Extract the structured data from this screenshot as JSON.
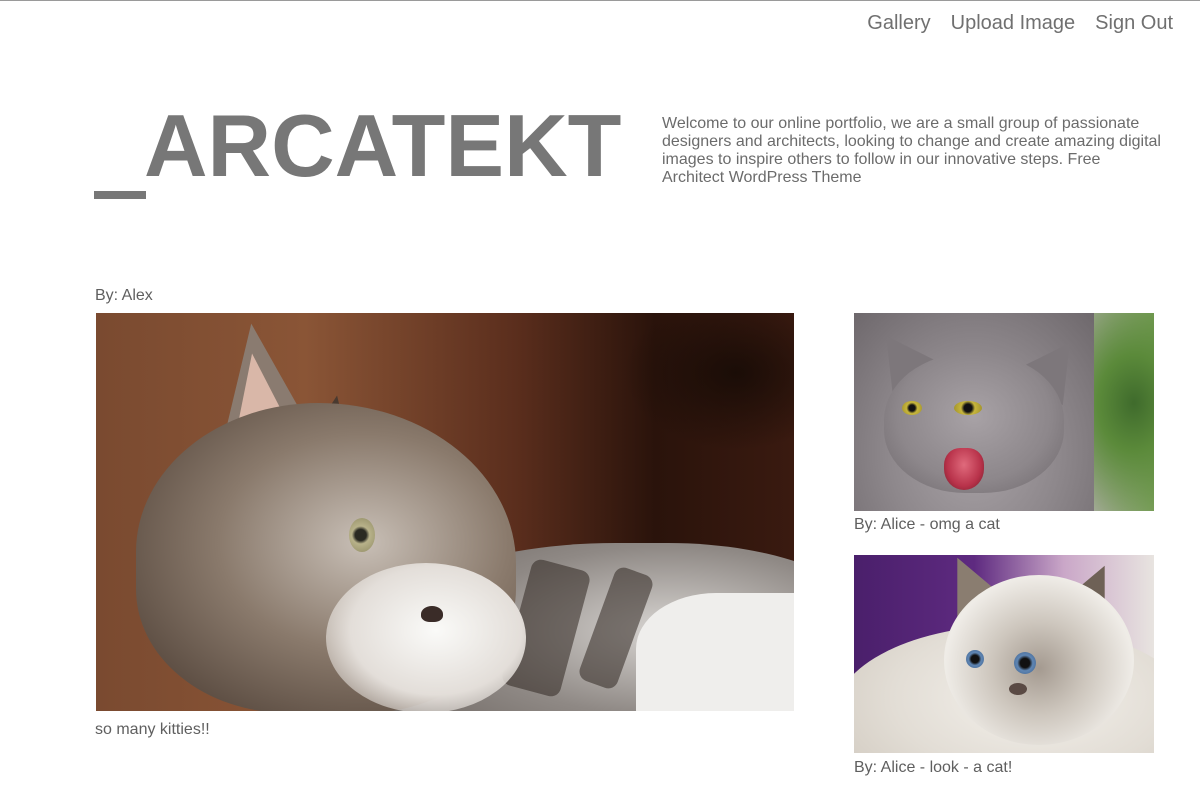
{
  "nav": {
    "items": [
      {
        "label": "Gallery"
      },
      {
        "label": "Upload Image"
      },
      {
        "label": "Sign Out"
      }
    ]
  },
  "header": {
    "logo_text": "ARCATEKT",
    "intro": "Welcome to our online portfolio, we are a small group of passionate designers and architects, looking to change and create amazing digital images to inspire others to follow in our innovative steps. Free Architect WordPress Theme"
  },
  "gallery": {
    "main": {
      "author": "By: Alex",
      "caption": "so many kitties!!"
    },
    "side": [
      {
        "caption": "By: Alice - omg a cat"
      },
      {
        "caption": "By: Alice - look - a cat!"
      }
    ]
  },
  "colors": {
    "text": "#6b6b6b",
    "logo": "#777777",
    "background": "#ffffff"
  }
}
